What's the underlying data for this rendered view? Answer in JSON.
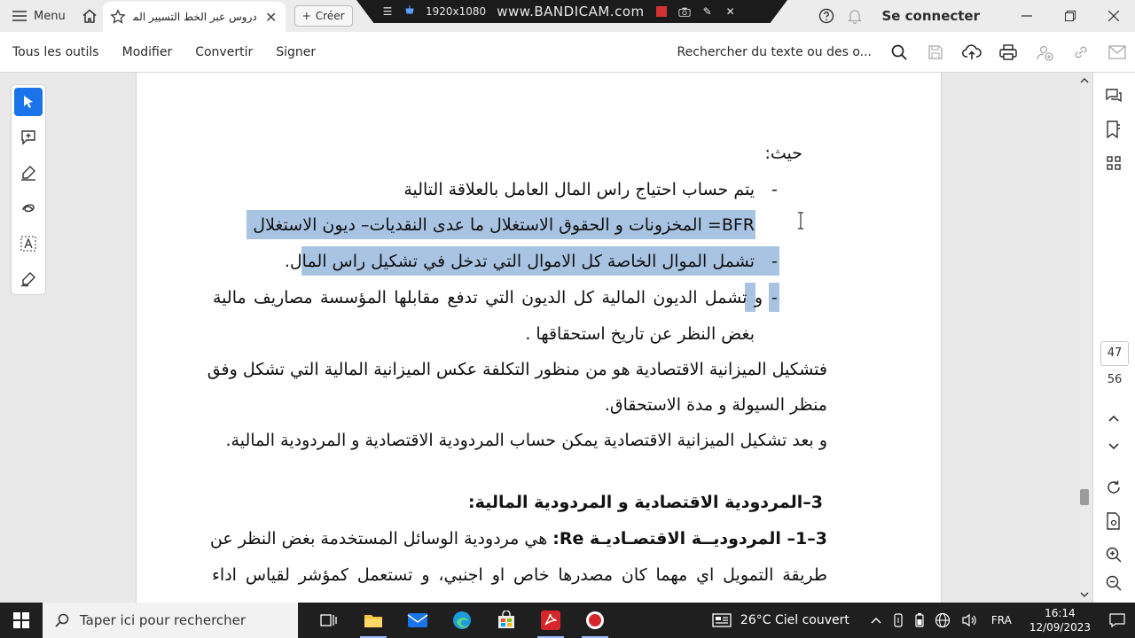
{
  "titlebar": {
    "menu_label": "Menu",
    "tab_title": "دروس عبر الخط التسيير الما...",
    "create_label": "Créer",
    "sign_in_label": "Se connecter"
  },
  "bandicam": {
    "resolution": "1920x1080",
    "logo": "www.BANDICAM.com"
  },
  "toolbar": {
    "menus": [
      "Tous les outils",
      "Modifier",
      "Convertir",
      "Signer"
    ],
    "search_placeholder": "Rechercher du texte ou des o..."
  },
  "document": {
    "lines": [
      "حيث:",
      "يتم حساب احتياج راس المال العامل بالعلاقة التالية",
      "= المخزونات و الحقوق الاستغلال ما عدى النقديات– ديون الاستغلال",
      "تشمل الموال الخاصة كل الاموال التي تدخل في تشكيل راس المال.",
      "و تشمل الديون المالية كل الديون التي تدفع مقابلها المؤسسة مصاريف مالية",
      "بغض النظر عن تاريخ استحقاقها .",
      "فتشكيل الميزانية الاقتصادية هو من منظور التكلفة عكس الميزانية المالية التي تشكل وفق",
      "منظر السيولة و مدة الاستحقاق.",
      "و بعد تشكيل الميزانية الاقتصادية يمكن حساب المردودية الاقتصادية و المردودية المالية.",
      "3–المردودية الاقتصادية و المردودية المالية:",
      "هي مردودية الوسائل المستخدمة بغض النظر عن",
      "طريقة التمويل اي مهما كان مصدرها خاص او اجنبي، و تستعمل كمؤشر لقياس اداء"
    ],
    "bfr_label": "BFR",
    "section_31_title": "3–1– المردوديــة الاقتصـاديـة Re:",
    "bullet": "-"
  },
  "right_rail": {
    "current_page": "47",
    "total_pages": "56"
  },
  "taskbar": {
    "search_placeholder": "Taper ici pour rechercher",
    "weather": "26°C  Ciel couvert",
    "language": "FRA",
    "time": "16:14",
    "date": "12/09/2023"
  },
  "colors": {
    "selection": "#a9c4e3",
    "accent": "#1a73e8",
    "acrobat_red": "#d7262b"
  },
  "icons": {
    "menu": "hamburger-icon",
    "home": "home-icon",
    "star": "star-icon",
    "search": "search-icon",
    "save": "save-icon",
    "upload": "upload-icon",
    "print": "print-icon",
    "share": "share-icon",
    "link": "link-icon",
    "mail": "mail-icon"
  }
}
